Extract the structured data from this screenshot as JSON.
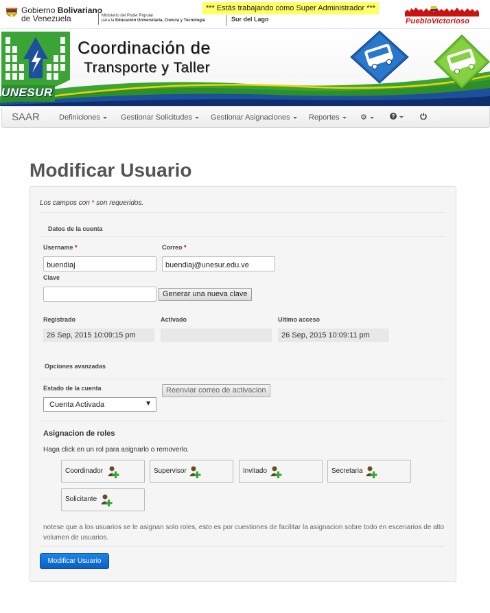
{
  "gov_header": {
    "name_line1": "Gobierno ",
    "name_line1_bold": "Bolivariano",
    "name_line2": "de Venezuela",
    "ministry_line1": "Ministerio del Poder Popular",
    "ministry_line2_prefix": "para la ",
    "ministry_line2_bold": "Educación Universitaria, Ciencia y Tecnología",
    "region": "Sur del Lago",
    "superadmin_notice": "*** Estás trabajando como Super Administrador ***",
    "pueblo_logo_text": "PuebloVictorioso"
  },
  "banner": {
    "title_line1": "Coordinación de",
    "title_line2": "Transporte y Taller",
    "logo_text": "UNESUR"
  },
  "navbar": {
    "brand": "SAAR",
    "items": [
      {
        "label": "Definiciones"
      },
      {
        "label": "Gestionar Solicitudes"
      },
      {
        "label": "Gestionar Asignaciones"
      },
      {
        "label": "Reportes"
      }
    ],
    "icons": [
      "gear-icon",
      "question-icon",
      "power-icon"
    ]
  },
  "page": {
    "title": "Modificar Usuario",
    "required_note_prefix": "Los campos con ",
    "required_star": "*",
    "required_note_suffix": " son requeridos."
  },
  "account": {
    "legend": "Datos de la cuenta",
    "username_label": "Username",
    "username_value": "buendiaj",
    "email_label": "Correo",
    "email_value": "buendiaj@unesur.edu.ve",
    "password_label": "Clave",
    "password_value": "",
    "generate_button": "Generar una nueva clave",
    "registered_label": "Registrado",
    "registered_value": "26 Sep, 2015 10:09:15 pm",
    "activated_label": "Activado",
    "activated_value": "",
    "last_access_label": "Ultimo acceso",
    "last_access_value": "26 Sep, 2015 10:09:11 pm"
  },
  "advanced": {
    "legend": "Opciones avanzadas",
    "status_label": "Estado de la cuenta",
    "status_value": "Cuenta Activada",
    "resend_button": "Reenviar correo de activacion"
  },
  "roles": {
    "title": "Asignacion de roles",
    "help": "Haga click en un rol para asignarlo o removerlo.",
    "items": [
      {
        "label": "Coordinador"
      },
      {
        "label": "Supervisor"
      },
      {
        "label": "Invitado"
      },
      {
        "label": "Secretaria"
      },
      {
        "label": "Solicitante"
      }
    ],
    "note": "notese que a los usuarios se le asignan solo roles, esto es por cuestiones de facilitar la asignacion sobre todo en escenarios de alto volumen de usuarios."
  },
  "submit_button": "Modificar Usuario",
  "colors": {
    "primary": "#0b5fc4",
    "superadmin_bg": "#ffff66",
    "required": "#cc0000",
    "banner_green": "#3aa536",
    "banner_blue": "#1e4f9c"
  }
}
